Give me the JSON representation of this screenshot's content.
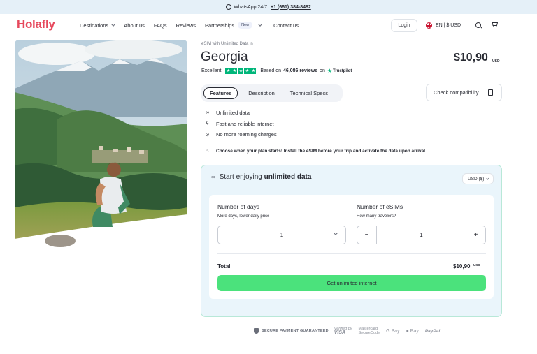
{
  "topbar": {
    "text": "WhatsApp 24/7:",
    "phone": "+1 (661) 384-8482"
  },
  "header": {
    "logo": "Holafly",
    "nav": [
      {
        "label": "Destinations"
      },
      {
        "label": "About us"
      },
      {
        "label": "FAQs"
      },
      {
        "label": "Reviews"
      },
      {
        "label": "Partnerships",
        "badge": "New"
      },
      {
        "label": "Contact us"
      }
    ],
    "login": "Login",
    "language": "EN | $ USD"
  },
  "product": {
    "kicker": "eSIM with Unlimited Data in",
    "title": "Georgia",
    "price": "$10,90",
    "currency": "USD",
    "rating": {
      "label": "Excellent",
      "based_on": "Based on",
      "reviews": "46,086 reviews",
      "on": "on",
      "platform": "Trustpilot",
      "stars": 5
    }
  },
  "tabs": [
    {
      "label": "Features",
      "active": true
    },
    {
      "label": "Description",
      "active": false
    },
    {
      "label": "Technical Specs",
      "active": false
    }
  ],
  "check_compat": "Check compatibility",
  "features": [
    {
      "icon": "infinity-icon",
      "text": "Unlimited data"
    },
    {
      "icon": "bolt-icon",
      "text": "Fast and reliable internet"
    },
    {
      "icon": "no-roaming-icon",
      "text": "No more roaming charges"
    }
  ],
  "note": "Choose when your plan starts! Install the eSIM before your trip and activate the data upon arrival.",
  "plan": {
    "heading_prefix": "Start enjoying",
    "heading_bold": "unlimited data",
    "currency_select": "USD ($)",
    "days_label": "Number of days",
    "days_sub": "More days, lower daily price",
    "days_value": "1",
    "esims_label": "Number of eSIMs",
    "esims_sub": "How many travelers?",
    "esims_value": "1",
    "total_label": "Total",
    "total_value": "$10,90",
    "total_currency": "USD",
    "cta": "Get unlimited internet"
  },
  "payments": {
    "secure": "SECURE PAYMENT GUARANTEED",
    "visa_top": "Verified by",
    "visa_bottom": "VISA",
    "mc_top": "Mastercard",
    "mc_bottom": "SecureCode",
    "gpay": "G Pay",
    "apay": " Pay",
    "paypal": "PayPal"
  },
  "colors": {
    "brand": "#e6485c",
    "cta": "#4be27c",
    "trustpilot": "#00b67a",
    "banner": "#e5f0f8"
  }
}
